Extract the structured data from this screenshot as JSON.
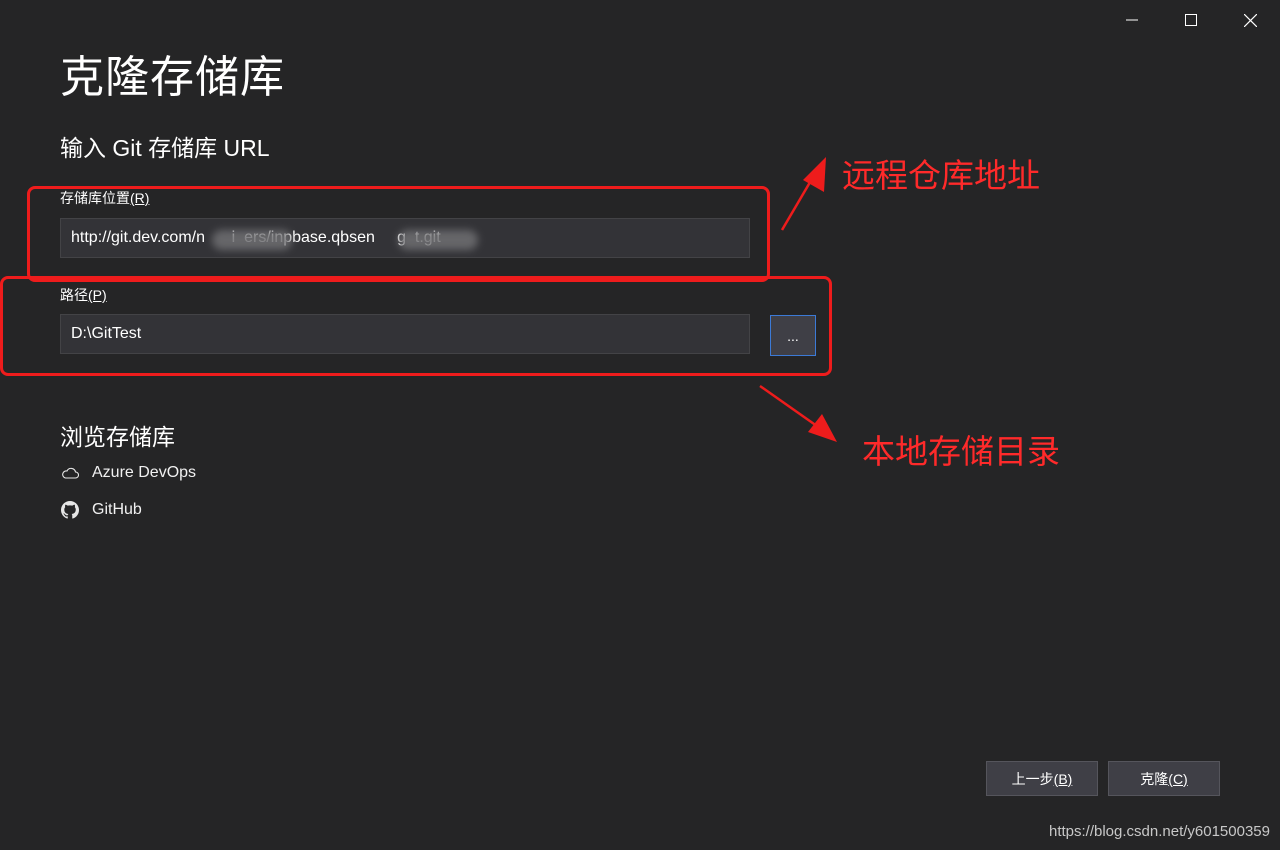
{
  "window": {
    "minimize_icon": "minimize-icon",
    "maximize_icon": "maximize-icon",
    "close_icon": "close-icon"
  },
  "page": {
    "title": "克隆存储库",
    "subtitle": "输入 Git 存储库 URL"
  },
  "repo_location": {
    "label": "存储库位置",
    "access_key": "(R)",
    "value": "http://git.dev.com/n      i  ers/inpbase.qbsen     g  t.git"
  },
  "path": {
    "label": "路径",
    "access_key": "(P)",
    "value": "D:\\GitTest",
    "browse_label": "..."
  },
  "browse": {
    "title": "浏览存储库",
    "items": [
      {
        "label": "Azure DevOps",
        "icon": "cloud-icon"
      },
      {
        "label": "GitHub",
        "icon": "github-icon"
      }
    ]
  },
  "annotations": {
    "remote": "远程仓库地址",
    "local": "本地存储目录",
    "color": "#ee1c1c"
  },
  "footer": {
    "back_label": "上一步",
    "back_key": "(B)",
    "clone_label": "克隆",
    "clone_key": "(C)"
  },
  "watermark": "https://blog.csdn.net/y601500359"
}
